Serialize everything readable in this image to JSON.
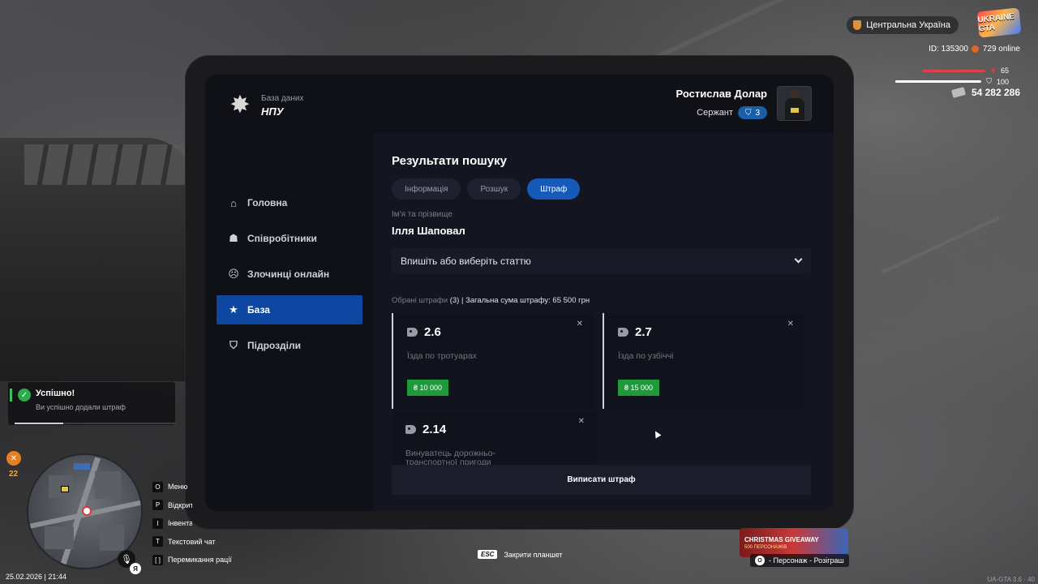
{
  "hud": {
    "region": "Центральна Україна",
    "brand_logo": "UKRAINE GTA",
    "id_label": "ID: 135300",
    "online_label": "729 online",
    "health_value": "65",
    "health_fraction": 0.65,
    "armor_value": "100",
    "armor_fraction": 1.0,
    "money": "54 282 286",
    "colors": {
      "health": "#e0404a",
      "armor": "#ffffff",
      "online": "#e2662c"
    }
  },
  "tablet": {
    "logo_sub": "База даних",
    "logo_main": "НПУ",
    "logo_icon": "police-star-icon",
    "profile": {
      "name": "Ростислав Долар",
      "rank": "Сержант",
      "rank_level": "3"
    },
    "nav": [
      {
        "label": "Головна",
        "icon": "home-icon",
        "glyph": "⌂"
      },
      {
        "label": "Співробітники",
        "icon": "staff-icon",
        "glyph": "☗"
      },
      {
        "label": "Злочинці онлайн",
        "icon": "criminal-icon",
        "glyph": "☹"
      },
      {
        "label": "База",
        "icon": "star-icon",
        "glyph": "★",
        "active": true
      },
      {
        "label": "Підрозділи",
        "icon": "shield-icon",
        "glyph": "⛉"
      }
    ],
    "section_title": "Результати пошуку",
    "tabs": [
      {
        "label": "Інформація",
        "active": false
      },
      {
        "label": "Розшук",
        "active": false
      },
      {
        "label": "Штраф",
        "active": true
      }
    ],
    "field_label": "Ім'я та прізвище",
    "person_name": "Ілля Шаповал",
    "select_placeholder": "Впишіть або виберіть статтю",
    "summary": {
      "prefix": "Обрані штрафи",
      "count": "(3)",
      "separator": " | ",
      "total": "Загальна сума штрафу: 65 500 грн"
    },
    "fines": [
      {
        "code": "2.6",
        "description": "Їзда по тротуарах",
        "price": "₴ 10 000"
      },
      {
        "code": "2.7",
        "description": "Їзда по узбіччі",
        "price": "₴ 15 000"
      },
      {
        "code": "2.14",
        "description": "Винуватець дорожньо-транспортної пригоди",
        "price": ""
      }
    ],
    "issue_button": "Виписати штраф"
  },
  "toast": {
    "title": "Успішно!",
    "message": "Ви успішно додали штраф",
    "progress": 0.3
  },
  "food_value": "22",
  "keys": [
    {
      "key": "O",
      "label": "Меню"
    },
    {
      "key": "P",
      "label": "Відкрити"
    },
    {
      "key": "I",
      "label": "Інвентар"
    },
    {
      "key": "T",
      "label": "Текстовий чат"
    },
    {
      "key": "[ ]",
      "label": "Перемикання рації"
    }
  ],
  "lang": "Я",
  "datetime": "25.02.2026 | 21:44",
  "esc_hint": {
    "key": "ESC",
    "label": "Закрити планшет"
  },
  "promo": {
    "title": "CHRISTMAS GIVEAWAY",
    "subtitle": "500 ПЕРСОНАЖІВ",
    "key": "O",
    "label": "- Персонаж - Розіграш"
  },
  "version": "UA-GTA 3.6 · 40"
}
